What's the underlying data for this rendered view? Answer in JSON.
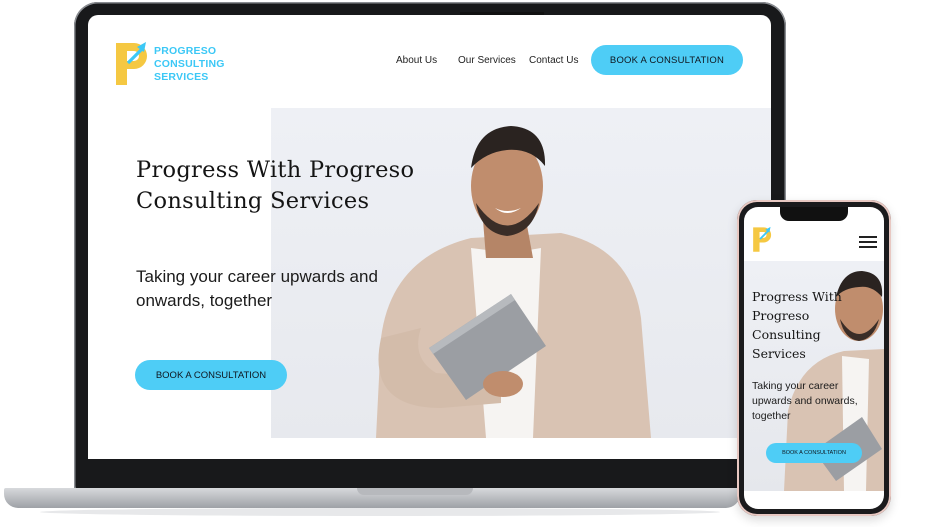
{
  "brand": {
    "name_line1": "PROGRESO",
    "name_line2": "CONSULTING",
    "name_line3": "SERVICES",
    "accent_color": "#4ecdf6",
    "logo_color": "#f5c842"
  },
  "nav": {
    "items": [
      "About Us",
      "Our Services",
      "Contact Us"
    ],
    "cta_label": "BOOK A CONSULTATION"
  },
  "hero": {
    "title": "Progress With Progreso Consulting Services",
    "subtitle": "Taking your career upwards and onwards, together",
    "cta_label": "BOOK A CONSULTATION"
  },
  "mobile": {
    "menu_icon": "hamburger-menu-icon",
    "title": "Progress With Progreso Consulting Services",
    "subtitle": "Taking your career upwards and onwards, together",
    "cta_label": "BOOK A CONSULTATION"
  }
}
